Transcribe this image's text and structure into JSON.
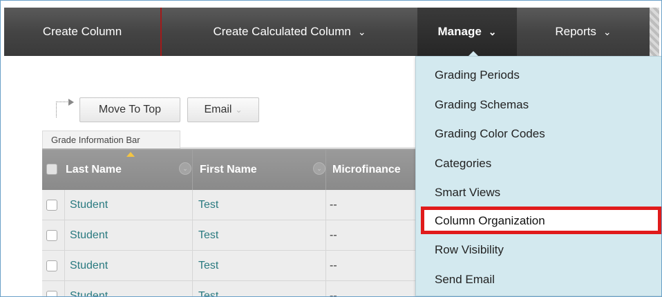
{
  "topbar": {
    "create_column": "Create Column",
    "create_calculated_column": "Create Calculated Column",
    "manage": "Manage",
    "reports": "Reports"
  },
  "actions": {
    "move_to_top": "Move To Top",
    "email": "Email"
  },
  "info_bar": "Grade Information Bar",
  "grid": {
    "headers": [
      "Last Name",
      "First Name",
      "Microfinance"
    ],
    "rows": [
      {
        "last": "Student",
        "first": "Test",
        "value": "--"
      },
      {
        "last": "Student",
        "first": "Test",
        "value": "--"
      },
      {
        "last": "Student",
        "first": "Test",
        "value": "--"
      },
      {
        "last": "Student",
        "first": "Test",
        "value": "--"
      }
    ]
  },
  "manage_menu": {
    "items": [
      "Grading Periods",
      "Grading Schemas",
      "Grading Color Codes",
      "Categories",
      "Smart Views",
      "Column Organization",
      "Row Visibility",
      "Send Email"
    ],
    "highlighted_index": 5,
    "highlight_color": "#e01b1b"
  },
  "colors": {
    "topbar": "#444444",
    "menu_bg": "#d3e9ef",
    "link": "#2a7a80"
  }
}
